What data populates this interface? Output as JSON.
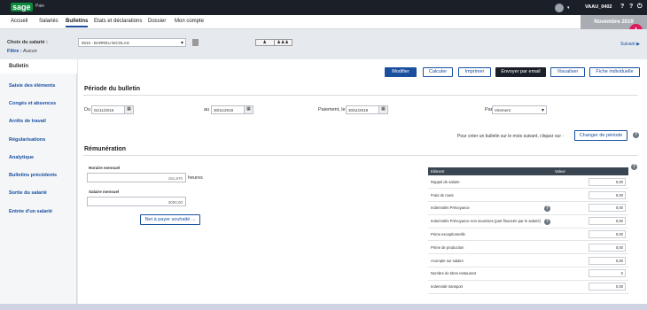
{
  "topbar": {
    "logo": "sage",
    "app": "Paie",
    "user": "VAAU_0402",
    "dropdown": "▾",
    "help": "?",
    "tips": "?",
    "power": "⏻"
  },
  "nav": [
    "Accueil",
    "Salariés",
    "Bulletins",
    "Etats et déclarations",
    "Dossier",
    "Mon compte"
  ],
  "month_tab": "Novembre 2019",
  "fab": "+",
  "employee": {
    "label": "Choix du salarié :",
    "filter_label": "Filtre :",
    "filter_value": "Aucun",
    "selected": "0010 - BARREU NICOLAS",
    "next": "Suivant ▶"
  },
  "sidebar": {
    "active": "Bulletin",
    "items": [
      "Saisie des éléments",
      "Congés et absences",
      "Arrêts de travail",
      "Régularisations",
      "Analytique",
      "Bulletins précédents",
      "Sortie du salarié",
      "Entrée d'un salarié"
    ]
  },
  "toolbar": {
    "modifier": "Modifier",
    "calculer": "Calculer",
    "imprimer": "Imprimer",
    "envoyer": "Envoyer par email",
    "visualiser": "Visualiser",
    "fiche": "Fiche individuelle"
  },
  "periode": {
    "title": "Période du bulletin",
    "du_label": "Du",
    "du": "01/11/2019",
    "au_label": "au",
    "au": "30/11/2019",
    "paiement_label": "Paiement, le",
    "paiement": "30/11/2019",
    "par_label": "Par",
    "par": "Virement",
    "create_text": "Pour créer un bulletin sur le mois suivant, cliquez sur :",
    "change_btn": "Changer de période"
  },
  "remuneration": {
    "title": "Rémunération",
    "horaire_label": "Horaire mensuel",
    "horaire": "151,670",
    "heures": "heures",
    "salaire_label": "Salaire mensuel",
    "salaire": "3000,00",
    "net_btn": "Net à payer souhaité ..."
  },
  "table": {
    "headers": [
      "Elément",
      "Valeur"
    ],
    "rows": [
      {
        "label": "Rappel de salaire",
        "value": "0,00",
        "help": false
      },
      {
        "label": "Frais de route",
        "value": "0,00",
        "help": false
      },
      {
        "label": "Indemnités Prévoyance",
        "value": "0,00",
        "help": true
      },
      {
        "label": "Indemnités Prévoyance non soumises (part financée par le salarié)",
        "value": "0,00",
        "help": true
      },
      {
        "label": "Prime exceptionnelle",
        "value": "0,00",
        "help": false
      },
      {
        "label": "Prime de production",
        "value": "0,00",
        "help": false
      },
      {
        "label": "Acompte sur salaire",
        "value": "0,00",
        "help": false
      },
      {
        "label": "Nombre de titres restaurant",
        "value": "0",
        "help": false
      },
      {
        "label": "Indemnité transport",
        "value": "0,00",
        "help": false
      }
    ]
  }
}
